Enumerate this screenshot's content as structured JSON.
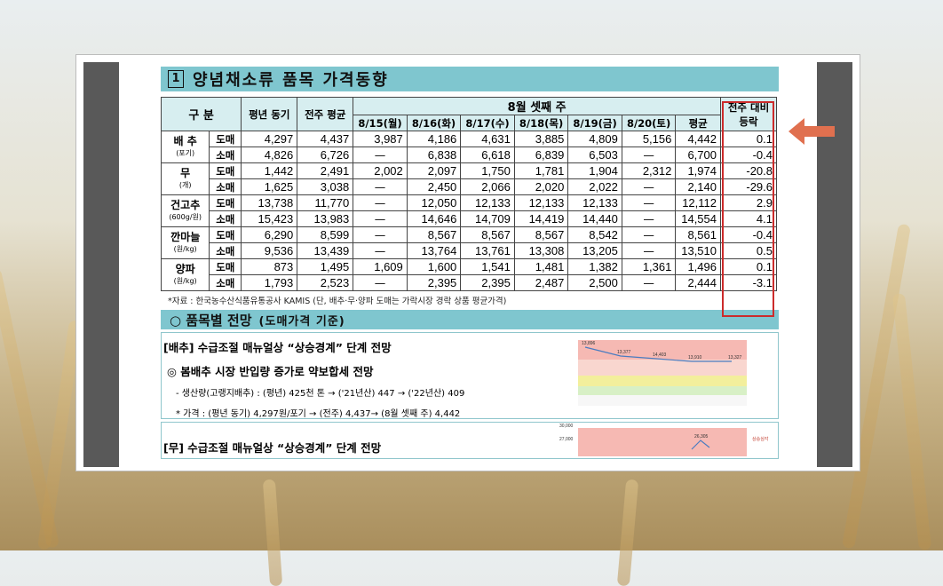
{
  "section1": {
    "number": "1",
    "title": "양념채소류 품목 가격동향"
  },
  "table": {
    "header_category": "구 분",
    "header_last_year": "평년 동기",
    "header_prev_week": "전주 평균",
    "header_week": "8월 셋째 주",
    "header_change_1": "전주 대비",
    "header_change_2": "등락",
    "days": [
      "8/15(월)",
      "8/16(화)",
      "8/17(수)",
      "8/18(목)",
      "8/19(금)",
      "8/20(토)",
      "평균"
    ],
    "items": [
      {
        "name": "배 추",
        "unit": "(포기)",
        "rows": [
          {
            "type": "도매",
            "values": [
              "4,297",
              "4,437",
              "3,987",
              "4,186",
              "4,631",
              "3,885",
              "4,809",
              "5,156",
              "4,442",
              "0.1"
            ]
          },
          {
            "type": "소매",
            "values": [
              "4,826",
              "6,726",
              "—",
              "6,838",
              "6,618",
              "6,839",
              "6,503",
              "—",
              "6,700",
              "-0.4"
            ]
          }
        ]
      },
      {
        "name": "무",
        "unit": "(개)",
        "rows": [
          {
            "type": "도매",
            "values": [
              "1,442",
              "2,491",
              "2,002",
              "2,097",
              "1,750",
              "1,781",
              "1,904",
              "2,312",
              "1,974",
              "-20.8"
            ]
          },
          {
            "type": "소매",
            "values": [
              "1,625",
              "3,038",
              "—",
              "2,450",
              "2,066",
              "2,020",
              "2,022",
              "—",
              "2,140",
              "-29.6"
            ]
          }
        ]
      },
      {
        "name": "건고추",
        "unit": "(600g/원)",
        "rows": [
          {
            "type": "도매",
            "values": [
              "13,738",
              "11,770",
              "—",
              "12,050",
              "12,133",
              "12,133",
              "12,133",
              "—",
              "12,112",
              "2.9"
            ]
          },
          {
            "type": "소매",
            "values": [
              "15,423",
              "13,983",
              "—",
              "14,646",
              "14,709",
              "14,419",
              "14,440",
              "—",
              "14,554",
              "4.1"
            ]
          }
        ]
      },
      {
        "name": "깐마늘",
        "unit": "(원/kg)",
        "rows": [
          {
            "type": "도매",
            "values": [
              "6,290",
              "8,599",
              "—",
              "8,567",
              "8,567",
              "8,567",
              "8,542",
              "—",
              "8,561",
              "-0.4"
            ]
          },
          {
            "type": "소매",
            "values": [
              "9,536",
              "13,439",
              "—",
              "13,764",
              "13,761",
              "13,308",
              "13,205",
              "—",
              "13,510",
              "0.5"
            ]
          }
        ]
      },
      {
        "name": "양파",
        "unit": "(원/kg)",
        "rows": [
          {
            "type": "도매",
            "values": [
              "873",
              "1,495",
              "1,609",
              "1,600",
              "1,541",
              "1,481",
              "1,382",
              "1,361",
              "1,496",
              "0.1"
            ]
          },
          {
            "type": "소매",
            "values": [
              "1,793",
              "2,523",
              "—",
              "2,395",
              "2,395",
              "2,487",
              "2,500",
              "—",
              "2,444",
              "-3.1"
            ]
          }
        ]
      }
    ],
    "note": "*자료 : 한국농수산식품유통공사 KAMIS (단, 배추·무·양파 도매는 가락시장 경락 상품 평균가격)"
  },
  "section2": {
    "title": "○ 품목별 전망",
    "subtitle": "(도매가격 기준)"
  },
  "outlook_cabbage": {
    "heading": "[배추] 수급조절 매뉴얼상 “상승경계” 단계 전망",
    "sub": "◎ 봄배추 시장 반입량 증가로 약보합세 전망",
    "line1": "- 생산량(고랭지배추) : (평년) 425천 톤 → ('21년산) 447 → ('22년산) 409",
    "line2": "* 가격 : (평년 동기) 4,297원/포기 → (전주) 4,437→ (8월 셋째 주) 4,442"
  },
  "chart_cabbage": {
    "point_labels": [
      "13,896",
      "13,377",
      "14,403",
      "13,910",
      "13,327"
    ]
  },
  "outlook_radish": {
    "heading": "[무] 수급조절 매뉴얼상 “상승경계” 단계 전망"
  },
  "chart_radish": {
    "y_ticks": [
      "30,000",
      "27,000"
    ],
    "peak_label": "26,305",
    "legend": "상승심각"
  },
  "colors": {
    "accent_teal": "#7fc6cf",
    "highlight_red": "#cc2b2b",
    "arrow": "#e0704f"
  }
}
